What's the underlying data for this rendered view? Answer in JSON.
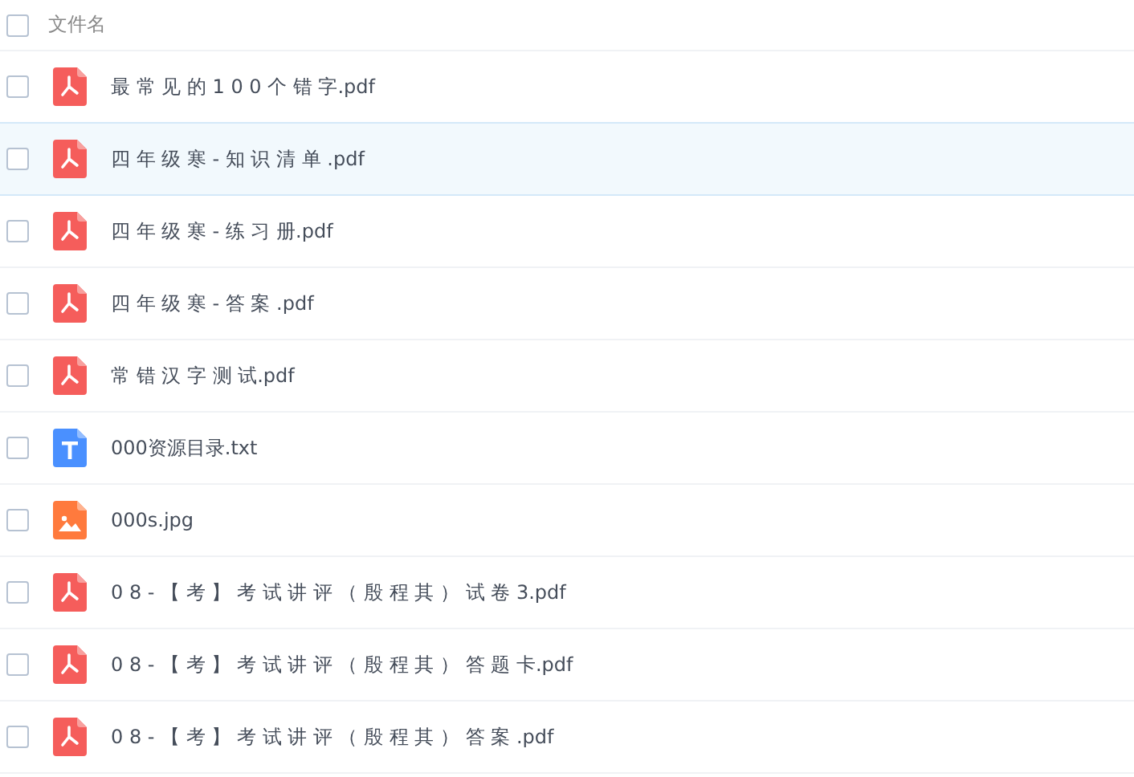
{
  "header": {
    "label": "文件名",
    "checked": false
  },
  "files": [
    {
      "name": "最 常 见 的 1 0 0 个 错 字.pdf",
      "kind": "pdf",
      "checked": false,
      "highlighted": false
    },
    {
      "name": "四 年 级 寒 - 知 识 清 单 .pdf",
      "kind": "pdf",
      "checked": false,
      "highlighted": true
    },
    {
      "name": "四 年 级 寒 - 练 习 册.pdf",
      "kind": "pdf",
      "checked": false,
      "highlighted": false
    },
    {
      "name": "四 年 级 寒 - 答 案 .pdf",
      "kind": "pdf",
      "checked": false,
      "highlighted": false
    },
    {
      "name": "常 错 汉 字 测 试.pdf",
      "kind": "pdf",
      "checked": false,
      "highlighted": false
    },
    {
      "name": "000资源目录.txt",
      "kind": "txt",
      "checked": false,
      "highlighted": false
    },
    {
      "name": "000s.jpg",
      "kind": "image",
      "checked": false,
      "highlighted": false
    },
    {
      "name": "0 8 - 【 考 】 考 试 讲 评 （ 殷 程 其 ） 试 卷 3.pdf",
      "kind": "pdf",
      "checked": false,
      "highlighted": false
    },
    {
      "name": "0 8 - 【 考 】 考 试 讲 评 （ 殷 程 其 ） 答 题 卡.pdf",
      "kind": "pdf",
      "checked": false,
      "highlighted": false
    },
    {
      "name": "0 8 - 【 考 】 考 试 讲 评 （ 殷 程 其 ） 答 案 .pdf",
      "kind": "pdf",
      "checked": false,
      "highlighted": false
    }
  ]
}
